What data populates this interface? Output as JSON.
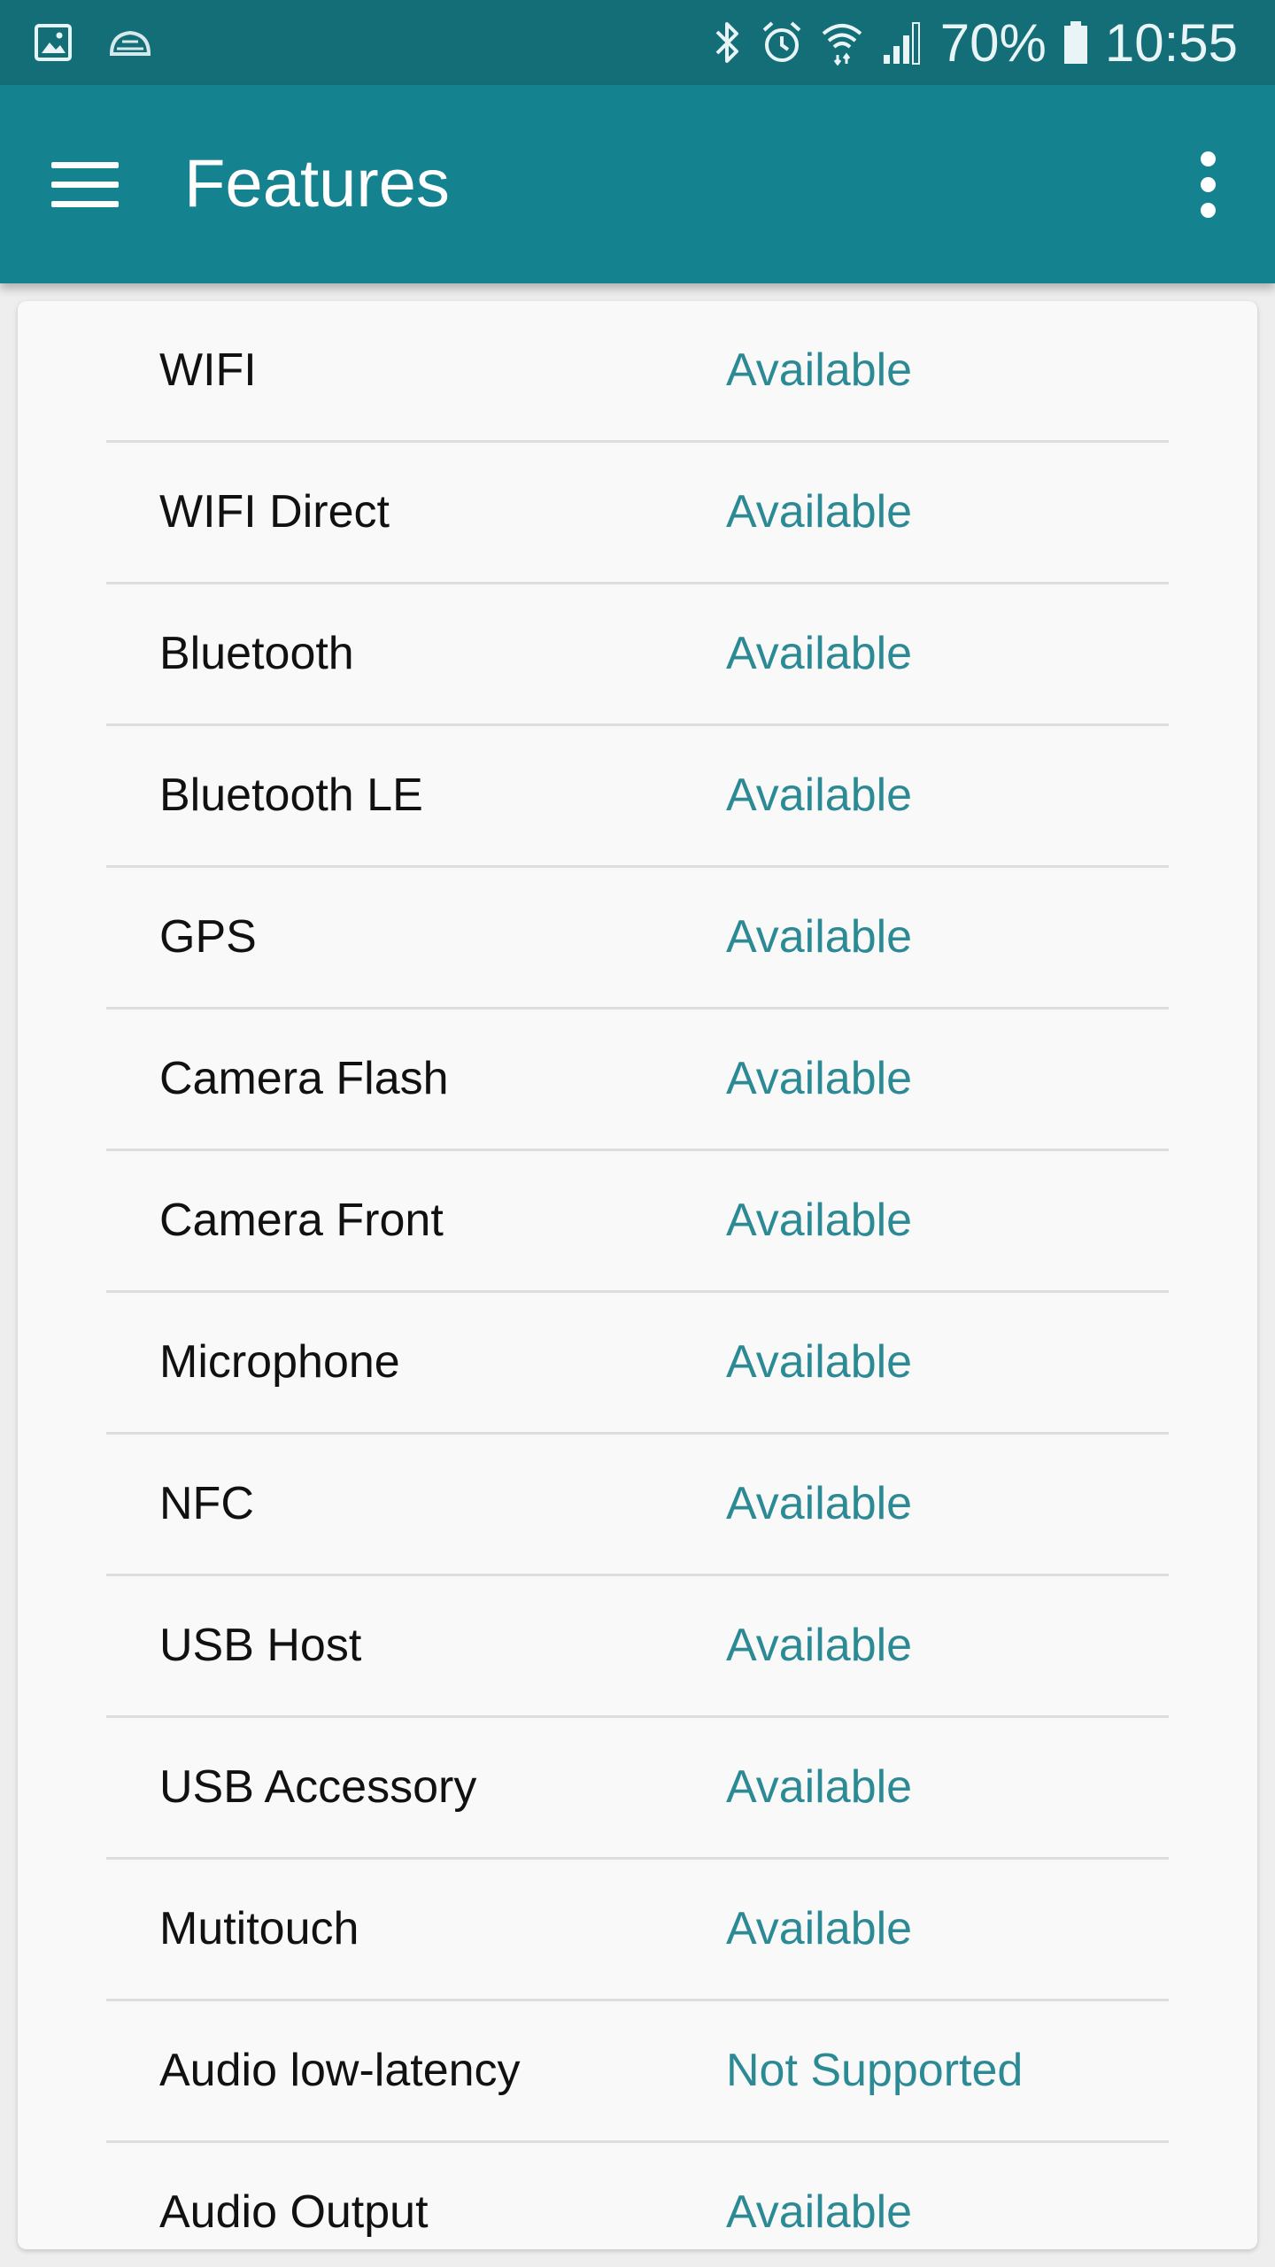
{
  "status_bar": {
    "battery_percent": "70%",
    "time": "10:55",
    "icons": [
      "gallery-notification-icon",
      "cloud-notification-icon",
      "bluetooth-icon",
      "alarm-icon",
      "wifi-icon",
      "signal-icon",
      "battery-icon"
    ],
    "bar_color": "#146e78"
  },
  "app_bar": {
    "title": "Features",
    "color": "#158290"
  },
  "accent_color": "#2c8a95",
  "features": [
    {
      "name": "WIFI",
      "status": "Available"
    },
    {
      "name": "WIFI Direct",
      "status": "Available"
    },
    {
      "name": "Bluetooth",
      "status": "Available"
    },
    {
      "name": "Bluetooth LE",
      "status": "Available"
    },
    {
      "name": "GPS",
      "status": "Available"
    },
    {
      "name": "Camera Flash",
      "status": "Available"
    },
    {
      "name": "Camera Front",
      "status": "Available"
    },
    {
      "name": "Microphone",
      "status": "Available"
    },
    {
      "name": "NFC",
      "status": "Available"
    },
    {
      "name": "USB Host",
      "status": "Available"
    },
    {
      "name": "USB Accessory",
      "status": "Available"
    },
    {
      "name": "Mutitouch",
      "status": "Available"
    },
    {
      "name": "Audio low-latency",
      "status": "Not Supported"
    },
    {
      "name": "Audio Output",
      "status": "Available"
    }
  ]
}
